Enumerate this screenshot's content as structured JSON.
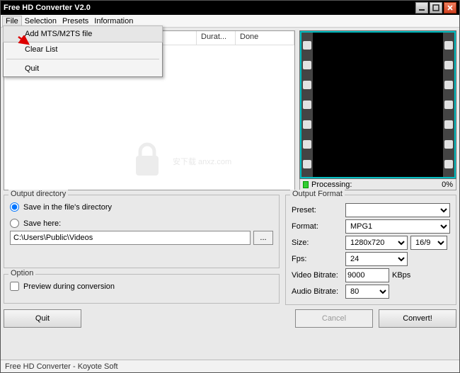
{
  "window": {
    "title": "Free HD Converter V2.0"
  },
  "menu": {
    "file": "File",
    "selection": "Selection",
    "presets": "Presets",
    "information": "Information"
  },
  "file_menu": {
    "add": "Add MTS/M2TS file",
    "clear": "Clear List",
    "quit": "Quit"
  },
  "columns": {
    "duration": "Durat...",
    "done": "Done"
  },
  "progress": {
    "label": "Processing:",
    "percent": "0%"
  },
  "output_dir": {
    "legend": "Output directory",
    "save_in_file": "Save in the file's directory",
    "save_here": "Save here:",
    "path": "C:\\Users\\Public\\Videos",
    "browse": "..."
  },
  "option": {
    "legend": "Option",
    "preview": "Preview during conversion"
  },
  "format": {
    "legend": "Output Format",
    "preset_label": "Preset:",
    "preset_value": "",
    "format_label": "Format:",
    "format_value": "MPG1",
    "size_label": "Size:",
    "size_value": "1280x720",
    "ratio_value": "16/9",
    "fps_label": "Fps:",
    "fps_value": "24",
    "vbitrate_label": "Video Bitrate:",
    "vbitrate_value": "9000",
    "vbitrate_unit": "KBps",
    "abitrate_label": "Audio Bitrate:",
    "abitrate_value": "80"
  },
  "buttons": {
    "quit": "Quit",
    "cancel": "Cancel",
    "convert": "Convert!"
  },
  "status": "Free HD Converter - Koyote Soft",
  "watermark": "安下载 anxz.com"
}
